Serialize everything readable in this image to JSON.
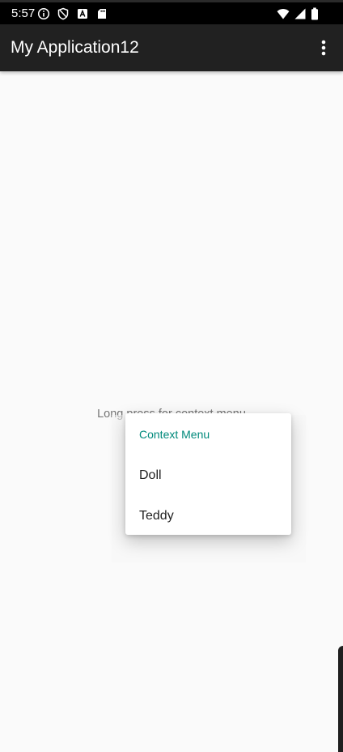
{
  "status_bar": {
    "time": "5:57",
    "left_icons": [
      "info-icon",
      "shield-icon",
      "a-box-icon",
      "sd-card-icon"
    ],
    "right_icons": [
      "wifi-icon",
      "signal-icon",
      "battery-icon"
    ]
  },
  "app_bar": {
    "title": "My Application12",
    "overflow_icon": "more-vert-icon"
  },
  "content": {
    "instruction": "Long press for context menu"
  },
  "context_menu": {
    "header": "Context Menu",
    "items": [
      {
        "label": "Doll"
      },
      {
        "label": "Teddy"
      }
    ]
  },
  "colors": {
    "status_bar": "#000000",
    "app_bar": "#212121",
    "accent": "#00897b",
    "background": "#fafafa"
  }
}
